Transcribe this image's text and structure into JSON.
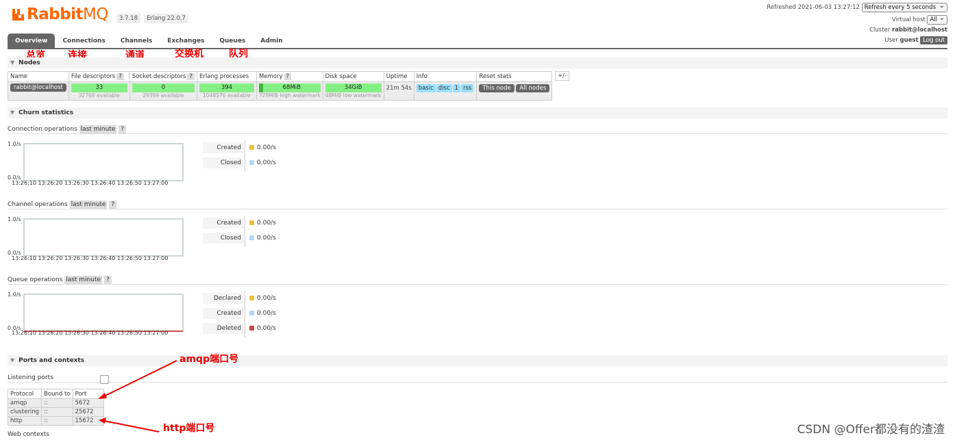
{
  "header": {
    "logo_text_bold": "Rabbit",
    "logo_text_light": "MQ",
    "version": "3.7.18",
    "erlang": "Erlang 22.0.7",
    "refreshed": "Refreshed 2021-06-03 13:27:12",
    "refresh_select": "Refresh every 5 seconds",
    "vhost_label": "Virtual host",
    "vhost_value": "All",
    "cluster_label": "Cluster",
    "cluster_value": "rabbit@localhost",
    "user_label": "User",
    "user_value": "guest",
    "logout": "Log out"
  },
  "tabs": [
    "Overview",
    "Connections",
    "Channels",
    "Exchanges",
    "Queues",
    "Admin"
  ],
  "annotations": {
    "overview": "总览",
    "connections": "连接",
    "channels": "通道",
    "exchanges": "交换机",
    "queues": "队列",
    "amqp_port": "amqp端口号",
    "http_port": "http端口号"
  },
  "nodes": {
    "section_title": "Nodes",
    "headers": [
      "Name",
      "File descriptors",
      "Socket descriptors",
      "Erlang processes",
      "Memory",
      "Disk space",
      "Uptime",
      "Info",
      "Reset stats"
    ],
    "help": "?",
    "plus_minus": "+/-",
    "name": "rabbit@localhost",
    "file_desc": "33",
    "file_desc_sub": "32768 available",
    "socket_desc": "0",
    "socket_desc_sub": "29399 available",
    "erlang_proc": "394",
    "erlang_proc_sub": "1048576 available",
    "memory": "68MiB",
    "memory_sub": "729MiB high watermark",
    "disk": "34GiB",
    "disk_sub": "48MiB low watermark",
    "uptime": "21m 54s",
    "info": [
      "basic",
      "disc",
      "1",
      "rss"
    ],
    "reset": [
      "This node",
      "All nodes"
    ]
  },
  "churn": {
    "section_title": "Churn statistics",
    "last_minute": "last minute",
    "y_top": "1.0/s",
    "y_bottom": "0.0/s",
    "x_ticks": [
      "13:26:10",
      "13:26:20",
      "13:26:30",
      "13:26:40",
      "13:26:50",
      "13:27:00"
    ],
    "connection": {
      "title": "Connection operations",
      "legend": [
        {
          "label": "Created",
          "value": "0.00/s",
          "color": "#edc240"
        },
        {
          "label": "Closed",
          "value": "0.00/s",
          "color": "#afd8f8"
        }
      ]
    },
    "channel": {
      "title": "Channel operations",
      "legend": [
        {
          "label": "Created",
          "value": "0.00/s",
          "color": "#edc240"
        },
        {
          "label": "Closed",
          "value": "0.00/s",
          "color": "#afd8f8"
        }
      ]
    },
    "queue": {
      "title": "Queue operations",
      "legend": [
        {
          "label": "Declared",
          "value": "0.00/s",
          "color": "#edc240"
        },
        {
          "label": "Created",
          "value": "0.00/s",
          "color": "#afd8f8"
        },
        {
          "label": "Deleted",
          "value": "0.00/s",
          "color": "#cb4b4b"
        }
      ]
    }
  },
  "ports": {
    "section_title": "Ports and contexts",
    "listening_label": "Listening ports",
    "headers": [
      "Protocol",
      "Bound to",
      "Port"
    ],
    "rows": [
      [
        "amqp",
        "::",
        "5672"
      ],
      [
        "clustering",
        "::",
        "25672"
      ],
      [
        "http",
        "::",
        "15672"
      ]
    ],
    "web_contexts": "Web contexts"
  },
  "watermark": "CSDN @Offer都没有的渣渣"
}
